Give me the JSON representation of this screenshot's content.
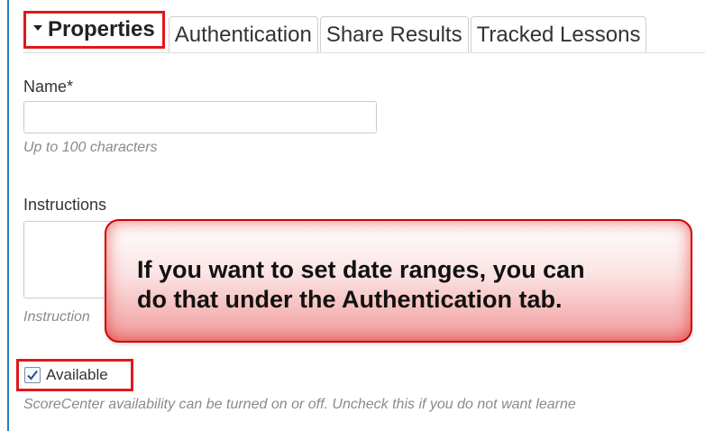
{
  "tabs": [
    {
      "label": "Properties",
      "active": true
    },
    {
      "label": "Authentication",
      "active": false
    },
    {
      "label": "Share Results",
      "active": false
    },
    {
      "label": "Tracked Lessons",
      "active": false
    }
  ],
  "form": {
    "name": {
      "label": "Name*",
      "value": "",
      "hint": "Up to 100 characters"
    },
    "instructions": {
      "label": "Instructions",
      "value": "",
      "hint_visible": "Instruction"
    },
    "available": {
      "label": "Available",
      "checked": true,
      "hint": "ScoreCenter availability can be turned on or off. Uncheck this if you do not want learne"
    }
  },
  "callout": {
    "line1": "If you want to set date ranges, you can",
    "line2": "do that under the Authentication tab."
  },
  "colors": {
    "highlight_border": "#e0181a",
    "frame_border": "#2e7bbf",
    "callout_border": "#d40000"
  },
  "icons": {
    "tab_caret": "caret-down-icon",
    "checkbox": "checkmark-icon"
  }
}
